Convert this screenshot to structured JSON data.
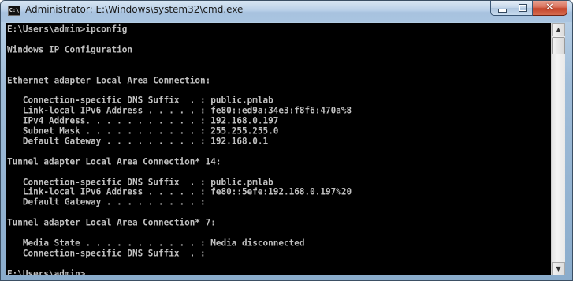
{
  "window": {
    "title": "Administrator: E:\\Windows\\system32\\cmd.exe",
    "icon_label": "C:\\",
    "buttons": {
      "minimize": "minimize",
      "maximize": "maximize",
      "close": "✕"
    }
  },
  "console": {
    "lines": [
      "E:\\Users\\admin>ipconfig",
      "",
      "Windows IP Configuration",
      "",
      "",
      "Ethernet adapter Local Area Connection:",
      "",
      "   Connection-specific DNS Suffix  . : public.pmlab",
      "   Link-local IPv6 Address . . . . . : fe80::ed9a:34e3:f8f6:470a%8",
      "   IPv4 Address. . . . . . . . . . . : 192.168.0.197",
      "   Subnet Mask . . . . . . . . . . . : 255.255.255.0",
      "   Default Gateway . . . . . . . . . : 192.168.0.1",
      "",
      "Tunnel adapter Local Area Connection* 14:",
      "",
      "   Connection-specific DNS Suffix  . : public.pmlab",
      "   Link-local IPv6 Address . . . . . : fe80::5efe:192.168.0.197%20",
      "   Default Gateway . . . . . . . . . :",
      "",
      "Tunnel adapter Local Area Connection* 7:",
      "",
      "   Media State . . . . . . . . . . . : Media disconnected",
      "   Connection-specific DNS Suffix  . :",
      "",
      "E:\\Users\\admin>"
    ]
  },
  "scrollbar": {
    "up_arrow": "▲",
    "down_arrow": "▼"
  }
}
